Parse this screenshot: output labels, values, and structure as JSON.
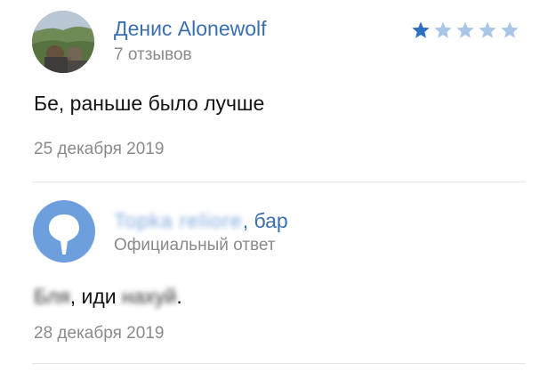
{
  "review": {
    "author_name": "Денис Alonewolf",
    "reviews_count": "7 отзывов",
    "rating": 1,
    "rating_max": 5,
    "star_color_filled": "#2f6fc0",
    "star_color_empty": "#a9c6e8",
    "text": "Бе, раньше было лучше",
    "date": "25 декабря 2019"
  },
  "reply": {
    "org_name_blurred": "Topka reliore",
    "org_suffix": ", бар",
    "label": "Официальный ответ",
    "text_blurred_1": "Бля",
    "text_middle": ", иди",
    "text_blurred_2": "нахуй",
    "text_end": ".",
    "date": "28 декабря 2019",
    "avatar_color": "#6e9fdd"
  }
}
